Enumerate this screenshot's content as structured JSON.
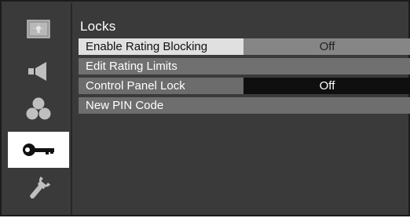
{
  "sidebar": {
    "items": [
      {
        "icon": "picture-icon",
        "active": false
      },
      {
        "icon": "speaker-icon",
        "active": false
      },
      {
        "icon": "channels-icon",
        "active": false
      },
      {
        "icon": "key-icon",
        "active": true
      },
      {
        "icon": "wrench-icon",
        "active": false
      }
    ]
  },
  "main": {
    "title": "Locks",
    "rows": [
      {
        "label": "Enable Rating Blocking",
        "value": "Off"
      },
      {
        "label": "Edit Rating Limits"
      },
      {
        "label": "Control Panel Lock",
        "value": "Off"
      },
      {
        "label": "New PIN Code"
      }
    ]
  },
  "colors": {
    "panel_bg": "#3a3a3a",
    "highlight": "#e0e0e0",
    "row_bg": "#707070",
    "value_selected_bg": "#0f0f0f"
  }
}
